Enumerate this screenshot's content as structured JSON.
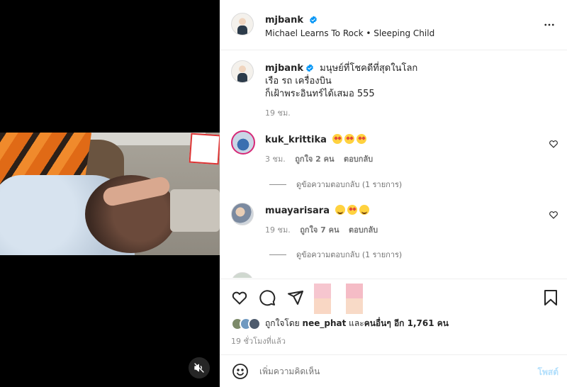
{
  "post": {
    "username": "mjbank",
    "audio": "Michael Learns To Rock • Sleeping Child",
    "caption_line1": "มนุษย์ที่โชคดีที่สุดในโลก",
    "caption_line2": "เรือ รถ เครื่องบิน",
    "caption_line3": "ก็เฝ้าพระอินทร์ได้เสมอ 555",
    "caption_time": "19 ชม.",
    "icons": [
      "verified-badge",
      "more-options",
      "mute"
    ]
  },
  "comments": [
    {
      "username": "kuk_krittika",
      "emojis": [
        "star-struck",
        "star-struck",
        "star-struck"
      ],
      "time": "3 ชม.",
      "likes": "ถูกใจ 2 คน",
      "reply_label": "ตอบกลับ",
      "view_replies": "ดูข้อความตอบกลับ (1 รายการ)"
    },
    {
      "username": "muayarisara",
      "emojis": [
        "smiling",
        "star-struck",
        "smiling"
      ],
      "time": "19 ชม.",
      "likes": "ถูกใจ 7 คน",
      "reply_label": "ตอบกลับ",
      "view_replies": "ดูข้อความตอบกลับ (1 รายการ)"
    }
  ],
  "engagement": {
    "liked_by_prefix": "ถูกใจโดย",
    "liked_by_user": "nee_phat",
    "liked_by_and": "และ",
    "liked_by_others": "คนอื่นๆ อีก 1,761 คน",
    "time_ago": "19 ชั่วโมงที่แล้ว",
    "icons": [
      "heart",
      "comment",
      "share",
      "bookmark"
    ]
  },
  "composer": {
    "placeholder": "เพิ่มความคิดเห็น",
    "post_label": "โพสต์"
  },
  "colors": {
    "verified": "#0095f6",
    "post_disabled": "#b2dffc",
    "muted_text": "#8e8e8e"
  }
}
